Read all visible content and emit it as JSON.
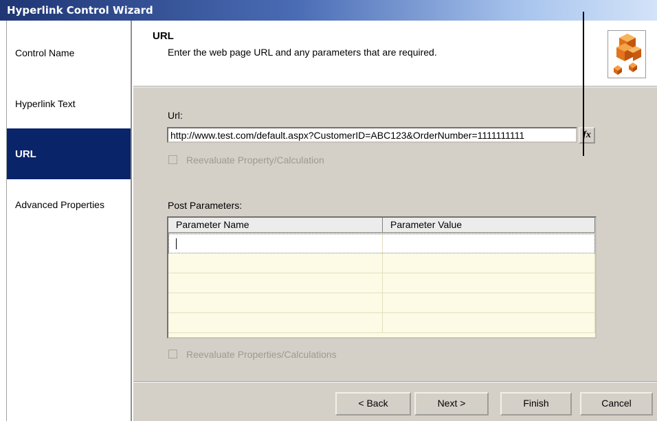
{
  "window": {
    "title": "Hyperlink Control Wizard"
  },
  "sidebar": {
    "items": [
      {
        "label": "Control Name",
        "active": false
      },
      {
        "label": "Hyperlink Text",
        "active": false
      },
      {
        "label": "URL",
        "active": true
      },
      {
        "label": "Advanced Properties",
        "active": false
      }
    ]
  },
  "header": {
    "title": "URL",
    "subtitle": "Enter the web page URL and any parameters that are required.",
    "logo_icon": "stacked-cubes-icon"
  },
  "form": {
    "url_label": "Url:",
    "url_value": "http://www.test.com/default.aspx?CustomerID=ABC123&OrderNumber=1111111111",
    "fx_label": "fx",
    "reevaluate_url_label": "Reevaluate Property/Calculation",
    "reevaluate_url_checked": false,
    "post_params_label": "Post Parameters:",
    "grid": {
      "columns": [
        "Parameter Name",
        "Parameter Value"
      ],
      "rows": [
        [
          "",
          ""
        ],
        [
          "",
          ""
        ],
        [
          "",
          ""
        ],
        [
          "",
          ""
        ],
        [
          "",
          ""
        ]
      ]
    },
    "reevaluate_params_label": "Reevaluate Properties/Calculations",
    "reevaluate_params_checked": false
  },
  "buttons": {
    "back": "< Back",
    "next": "Next >",
    "finish": "Finish",
    "cancel": "Cancel"
  },
  "colors": {
    "sidebar_active": "#0a246a",
    "dialog_face": "#d4d0c8",
    "grid_row": "#fdfbe5",
    "logo_orange": "#e8731b"
  }
}
